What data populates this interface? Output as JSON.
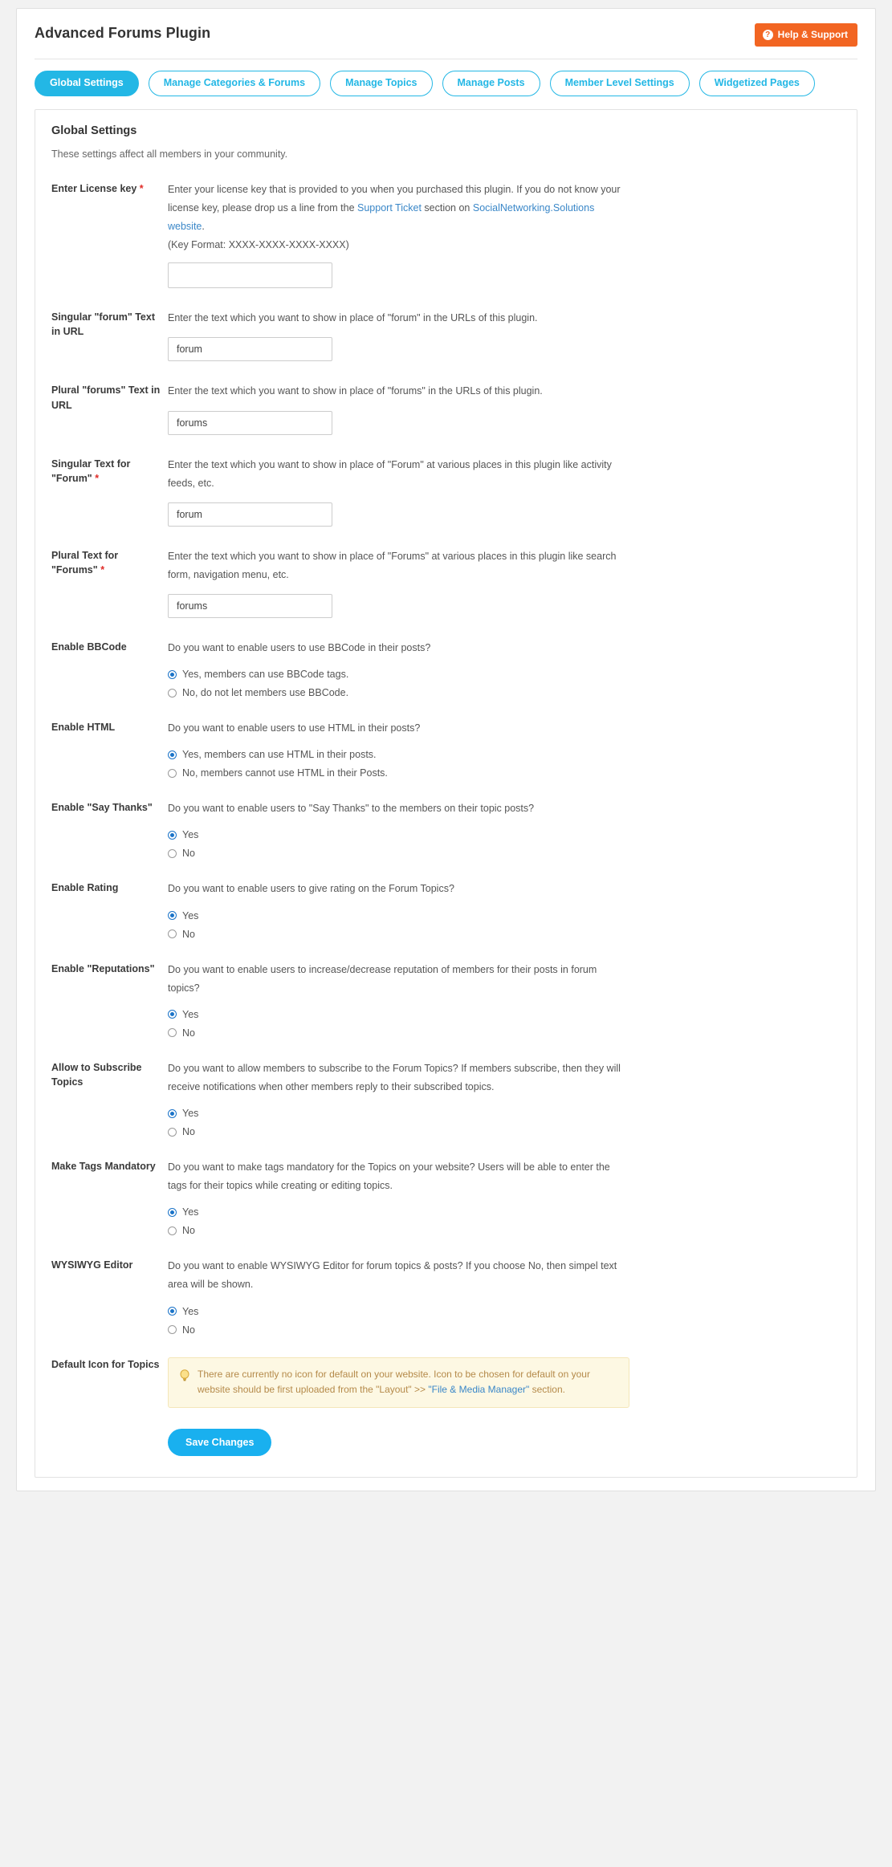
{
  "header": {
    "title": "Advanced Forums Plugin",
    "help_label": "Help & Support",
    "help_icon": "question-circle-icon"
  },
  "tabs": [
    {
      "label": "Global Settings",
      "active": true
    },
    {
      "label": "Manage Categories & Forums",
      "active": false
    },
    {
      "label": "Manage Topics",
      "active": false
    },
    {
      "label": "Manage Posts",
      "active": false
    },
    {
      "label": "Member Level Settings",
      "active": false
    },
    {
      "label": "Widgetized Pages",
      "active": false
    }
  ],
  "panel": {
    "title": "Global Settings",
    "subtitle": "These settings affect all members in your community.",
    "save_label": "Save Changes"
  },
  "settings": {
    "license": {
      "label": "Enter License key",
      "required": true,
      "desc_part1": "Enter your license key that is provided to you when you purchased this plugin. If you do not know your license key, please drop us a line from the ",
      "link1": "Support Ticket",
      "desc_part2": " section on ",
      "link2": "SocialNetworking.Solutions website",
      "desc_part3": ".",
      "key_format": "(Key Format: XXXX-XXXX-XXXX-XXXX)",
      "value": ""
    },
    "singular_url": {
      "label": "Singular \"forum\" Text in URL",
      "required": false,
      "desc": "Enter the text which you want to show in place of \"forum\" in the URLs of this plugin.",
      "value": "forum"
    },
    "plural_url": {
      "label": "Plural \"forums\" Text in URL",
      "required": false,
      "desc": "Enter the text which you want to show in place of \"forums\" in the URLs of this plugin.",
      "value": "forums"
    },
    "singular_text": {
      "label": "Singular Text for \"Forum\"",
      "required": true,
      "desc": "Enter the text which you want to show in place of \"Forum\" at various places in this plugin like activity feeds, etc.",
      "value": "forum"
    },
    "plural_text": {
      "label": "Plural Text for \"Forums\"",
      "required": true,
      "desc": "Enter the text which you want to show in place of \"Forums\" at various places in this plugin like search form, navigation menu, etc.",
      "value": "forums"
    },
    "bbcode": {
      "label": "Enable BBCode",
      "desc": "Do you want to enable users to use BBCode in their posts?",
      "options": [
        {
          "label": "Yes, members can use BBCode tags.",
          "checked": true
        },
        {
          "label": "No, do not let members use BBCode.",
          "checked": false
        }
      ]
    },
    "html": {
      "label": "Enable HTML",
      "desc": "Do you want to enable users to use HTML in their posts?",
      "options": [
        {
          "label": "Yes, members can use HTML in their posts.",
          "checked": true
        },
        {
          "label": "No, members cannot use HTML in their Posts.",
          "checked": false
        }
      ]
    },
    "say_thanks": {
      "label": "Enable \"Say Thanks\"",
      "desc": "Do you want to enable users to \"Say Thanks\" to the members on their topic posts?",
      "options": [
        {
          "label": "Yes",
          "checked": true
        },
        {
          "label": "No",
          "checked": false
        }
      ]
    },
    "rating": {
      "label": "Enable Rating",
      "desc": "Do you want to enable users to give rating on the Forum Topics?",
      "options": [
        {
          "label": "Yes",
          "checked": true
        },
        {
          "label": "No",
          "checked": false
        }
      ]
    },
    "reputations": {
      "label": "Enable \"Reputations\"",
      "desc": "Do you want to enable users to increase/decrease reputation of members for their posts in forum topics?",
      "options": [
        {
          "label": "Yes",
          "checked": true
        },
        {
          "label": "No",
          "checked": false
        }
      ]
    },
    "subscribe": {
      "label": "Allow to Subscribe Topics",
      "desc": "Do you want to allow members to subscribe to the Forum Topics? If members subscribe, then they will receive notifications when other members reply to their subscribed topics.",
      "options": [
        {
          "label": "Yes",
          "checked": true
        },
        {
          "label": "No",
          "checked": false
        }
      ]
    },
    "tags_mandatory": {
      "label": "Make Tags Mandatory",
      "desc": "Do you want to make tags mandatory for the Topics on your website? Users will be able to enter the tags for their topics while creating or editing topics.",
      "options": [
        {
          "label": "Yes",
          "checked": true
        },
        {
          "label": "No",
          "checked": false
        }
      ]
    },
    "wysiwyg": {
      "label": "WYSIWYG Editor",
      "desc": "Do you want to enable WYSIWYG Editor for forum topics & posts? If you choose No, then simpel text area will be shown.",
      "options": [
        {
          "label": "Yes",
          "checked": true
        },
        {
          "label": "No",
          "checked": false
        }
      ]
    },
    "default_icon": {
      "label": "Default Icon for Topics",
      "notice_icon": "lightbulb-icon",
      "notice_part1": "There are currently no icon for default on your website. Icon to be chosen for default on your website should be first uploaded from the \"Layout\" >> ",
      "notice_link": "\"File & Media Manager\"",
      "notice_part2": " section."
    }
  }
}
